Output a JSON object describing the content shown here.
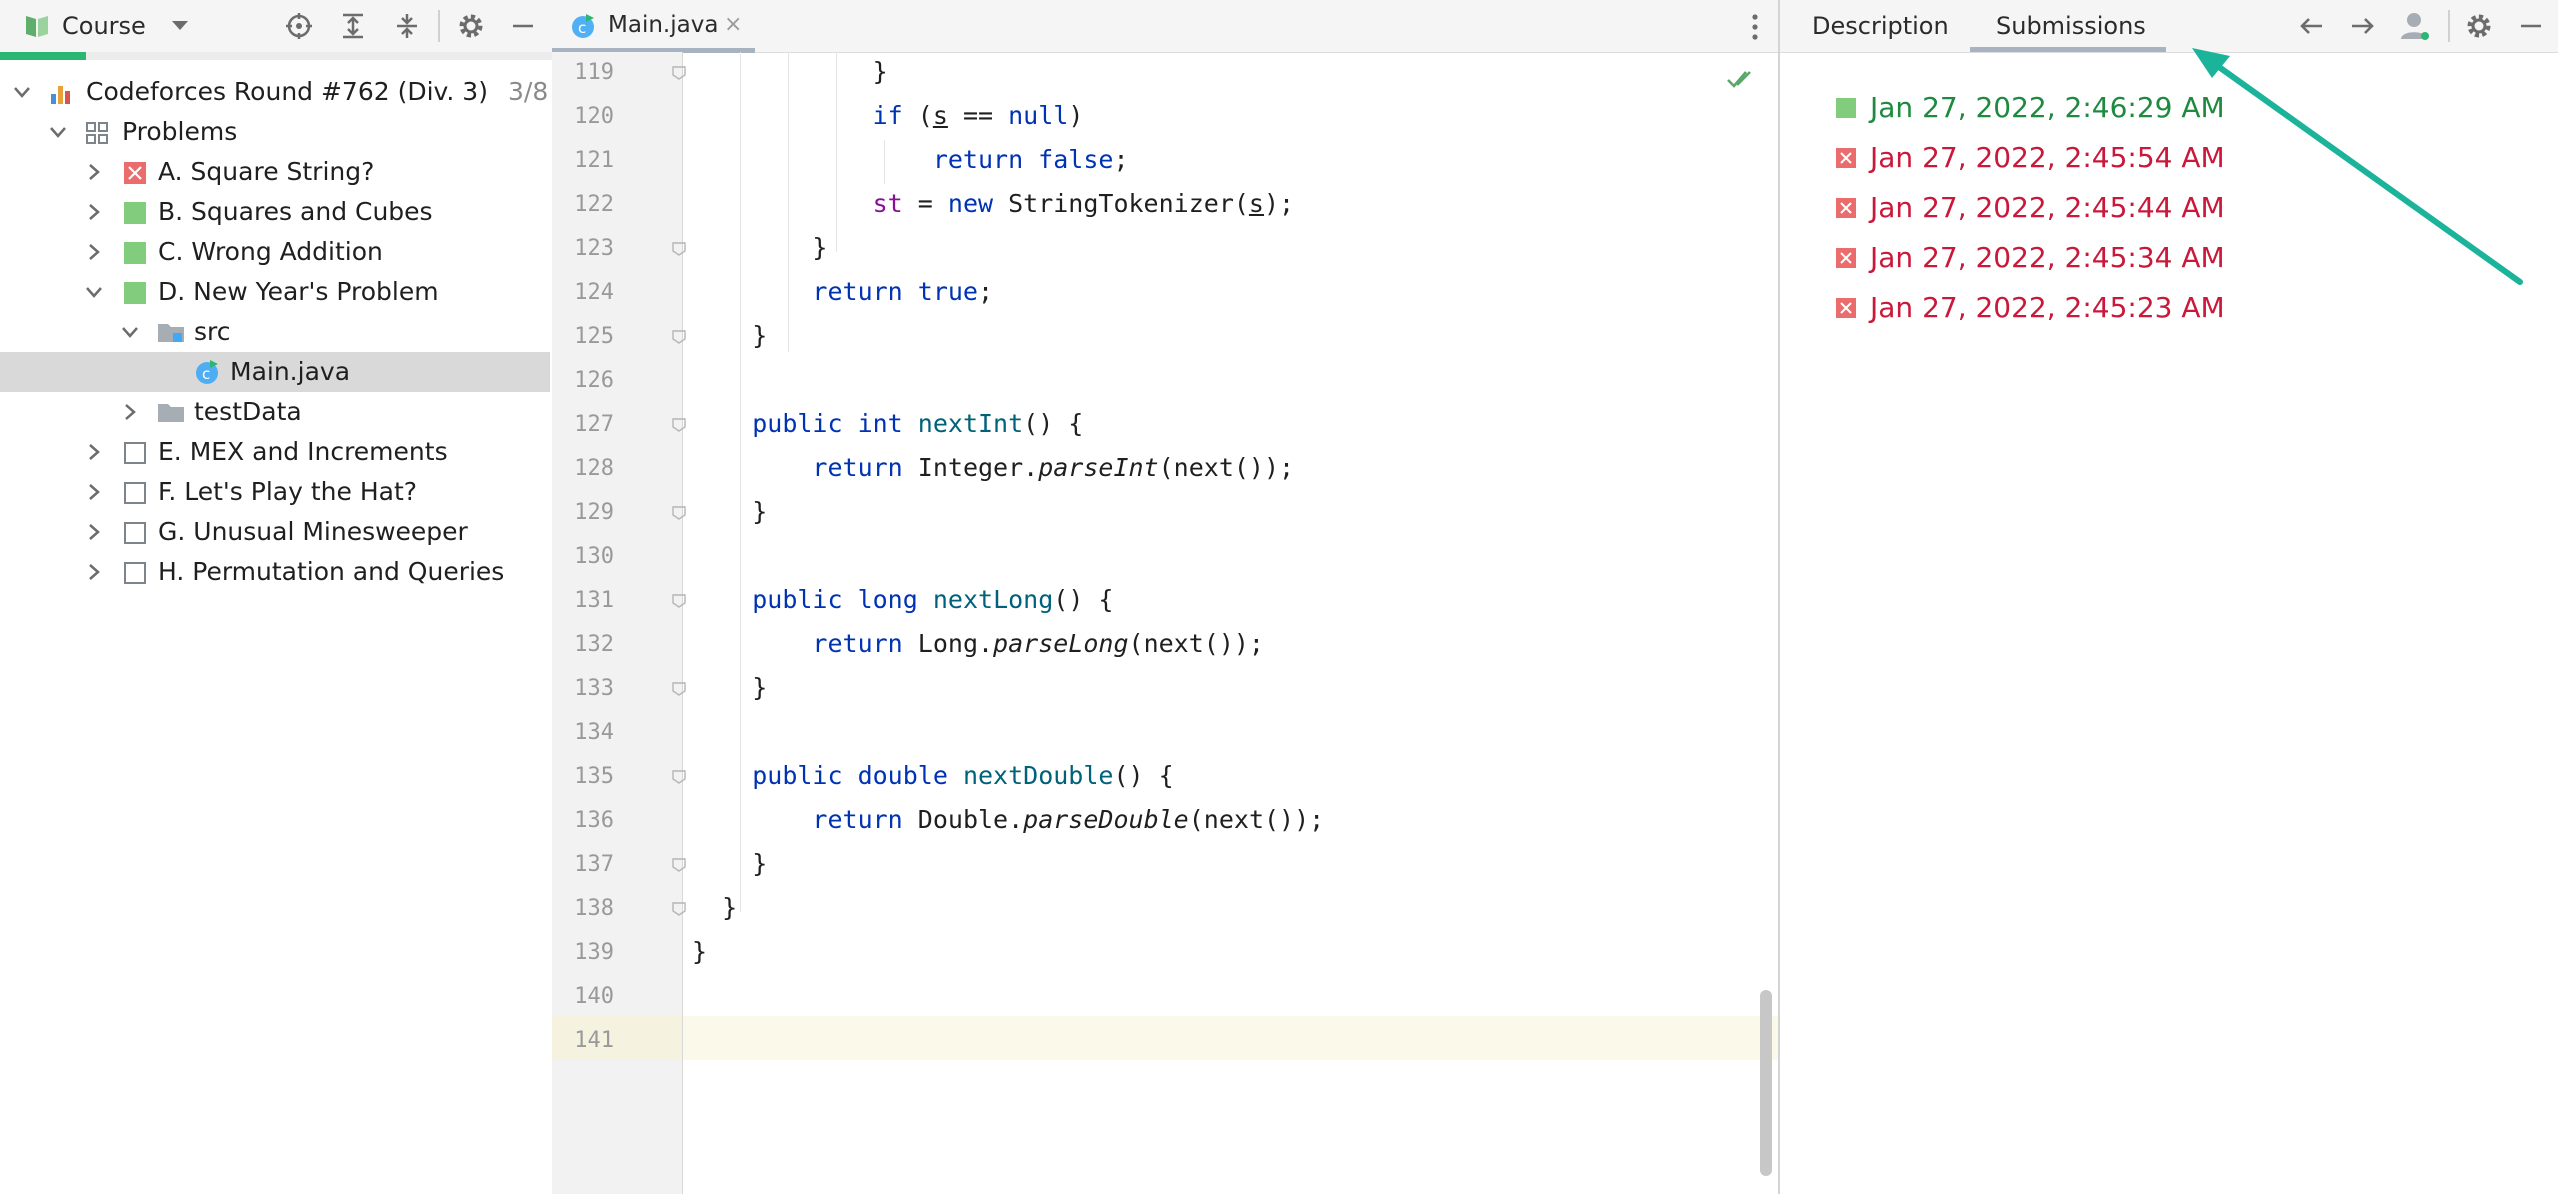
{
  "project": {
    "title": "Course",
    "progress_fraction": 0.155,
    "course": {
      "label": "Codeforces Round #762 (Div. 3)",
      "count": "3/8"
    },
    "problems_label": "Problems",
    "items": [
      {
        "label": "A. Square String?",
        "status": "failed"
      },
      {
        "label": "B. Squares and Cubes",
        "status": "solved"
      },
      {
        "label": "C. Wrong Addition",
        "status": "solved"
      },
      {
        "label": "D. New Year's Problem",
        "status": "solved"
      },
      {
        "label": "E. MEX and Increments",
        "status": "unchecked"
      },
      {
        "label": "F. Let's Play the Hat?",
        "status": "unchecked"
      },
      {
        "label": "G. Unusual Minesweeper",
        "status": "unchecked"
      },
      {
        "label": "H. Permutation and Queries",
        "status": "unchecked"
      }
    ],
    "src_label": "src",
    "file_label": "Main.java",
    "testdata_label": "testData"
  },
  "editor": {
    "tab_label": "Main.java",
    "tab_close": "×",
    "line_numbers": [
      "119",
      "120",
      "121",
      "122",
      "123",
      "124",
      "125",
      "126",
      "127",
      "128",
      "129",
      "130",
      "131",
      "132",
      "133",
      "134",
      "135",
      "136",
      "137",
      "138",
      "139",
      "140",
      "141"
    ]
  },
  "submissions": {
    "tabs": {
      "description": "Description",
      "submissions": "Submissions"
    },
    "items": [
      {
        "time": "Jan 27, 2022, 2:46:29 AM",
        "status": "ok"
      },
      {
        "time": "Jan 27, 2022, 2:45:54 AM",
        "status": "bad"
      },
      {
        "time": "Jan 27, 2022, 2:45:44 AM",
        "status": "bad"
      },
      {
        "time": "Jan 27, 2022, 2:45:34 AM",
        "status": "bad"
      },
      {
        "time": "Jan 27, 2022, 2:45:23 AM",
        "status": "bad"
      }
    ]
  },
  "colors": {
    "accent_green": "#2bb673",
    "ok": "#1d8a3f",
    "bad": "#c9183a",
    "arrow": "#1bb39a"
  }
}
